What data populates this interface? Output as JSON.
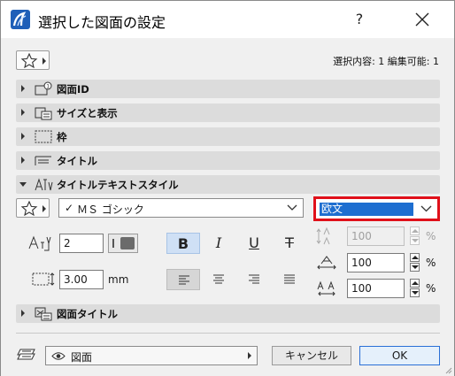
{
  "window": {
    "title": "選択した図面の設定",
    "help": "?"
  },
  "selection_info": "選択内容: 1 編集可能: 1",
  "sections": {
    "drawing_id": "図面ID",
    "size_display": "サイズと表示",
    "frame": "枠",
    "title": "タイトル",
    "title_text_style": "タイトルテキストスタイル",
    "drawing_title": "図面タイトル"
  },
  "text_style": {
    "font_check": "✓",
    "font_name": "ＭＳ ゴシック",
    "script": "欧文",
    "pen_value": "2",
    "height_value": "3.00",
    "height_unit": "mm",
    "bold": "B",
    "italic": "I",
    "underline": "U",
    "strikethrough": "T",
    "width_factor": "100",
    "spacing": "100",
    "line_spacing": "100",
    "percent": "%"
  },
  "footer": {
    "layer": "図面",
    "cancel": "キャンセル",
    "ok": "OK"
  },
  "colors": {
    "highlight": "#1e6ed0",
    "red_frame": "#e0101a",
    "section_bg": "#dcdcdc"
  }
}
